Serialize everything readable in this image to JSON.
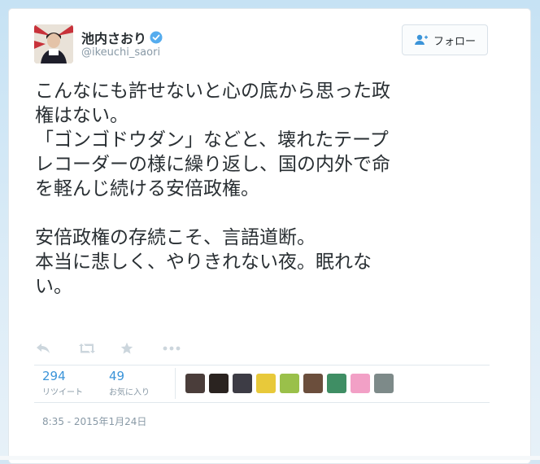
{
  "author": {
    "display_name": "池内さおり",
    "handle": "@ikeuchi_saori",
    "verified": true,
    "avatar_icon": "profile-photo"
  },
  "follow_button": {
    "label": "フォロー",
    "icon": "add-user-icon"
  },
  "tweet": {
    "paragraph1": [
      "こんなにも許せないと心の底から思った政",
      "権はない。",
      "「ゴンゴドウダン」などと、壊れたテープ",
      "レコーダーの様に繰り返し、国の内外で命",
      "を軽んじ続ける安倍政権。"
    ],
    "paragraph2": [
      "安倍政権の存続こそ、言語道断。",
      "本当に悲しく、やりきれない夜。眠れな",
      "い。"
    ]
  },
  "actions": {
    "icons": [
      "reply-icon",
      "retweet-icon",
      "favorite-icon",
      "more-icon"
    ]
  },
  "stats": {
    "retweets_count": "294",
    "retweets_label": "リツイート",
    "favorites_count": "49",
    "favorites_label": "お気に入り"
  },
  "faces": [
    "#4a3d3a",
    "#2a2320",
    "#3d3c45",
    "#e8c93a",
    "#9ac04a",
    "#6b4e3c",
    "#3f8e64",
    "#f2a0c6",
    "#7d8a89"
  ],
  "timestamp": "8:35 - 2015年1月24日",
  "colors": {
    "link_blue": "#3b94d9",
    "verified_blue": "#55acee",
    "text": "#292f33",
    "muted": "#8899a6"
  }
}
